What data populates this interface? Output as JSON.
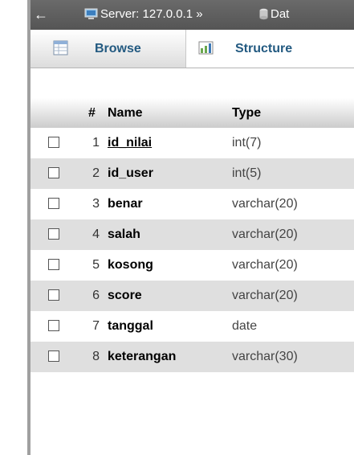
{
  "breadcrumb": {
    "server_text": "Server: 127.0.0.1 »",
    "database_text": "Dat"
  },
  "tabs": [
    {
      "label": "Browse",
      "icon": "table-browse-icon"
    },
    {
      "label": "Structure",
      "icon": "structure-icon",
      "active": true
    }
  ],
  "table": {
    "headers": {
      "num": "#",
      "name": "Name",
      "type": "Type"
    },
    "rows": [
      {
        "num": "1",
        "name": "id_nilai",
        "type": "int(7)",
        "primary": true
      },
      {
        "num": "2",
        "name": "id_user",
        "type": "int(5)"
      },
      {
        "num": "3",
        "name": "benar",
        "type": "varchar(20)"
      },
      {
        "num": "4",
        "name": "salah",
        "type": "varchar(20)"
      },
      {
        "num": "5",
        "name": "kosong",
        "type": "varchar(20)"
      },
      {
        "num": "6",
        "name": "score",
        "type": "varchar(20)"
      },
      {
        "num": "7",
        "name": "tanggal",
        "type": "date"
      },
      {
        "num": "8",
        "name": "keterangan",
        "type": "varchar(30)"
      }
    ]
  },
  "colors": {
    "topbar": "#5e5e5e",
    "tab_text": "#235a81",
    "row_alt": "#dfdfdf"
  }
}
